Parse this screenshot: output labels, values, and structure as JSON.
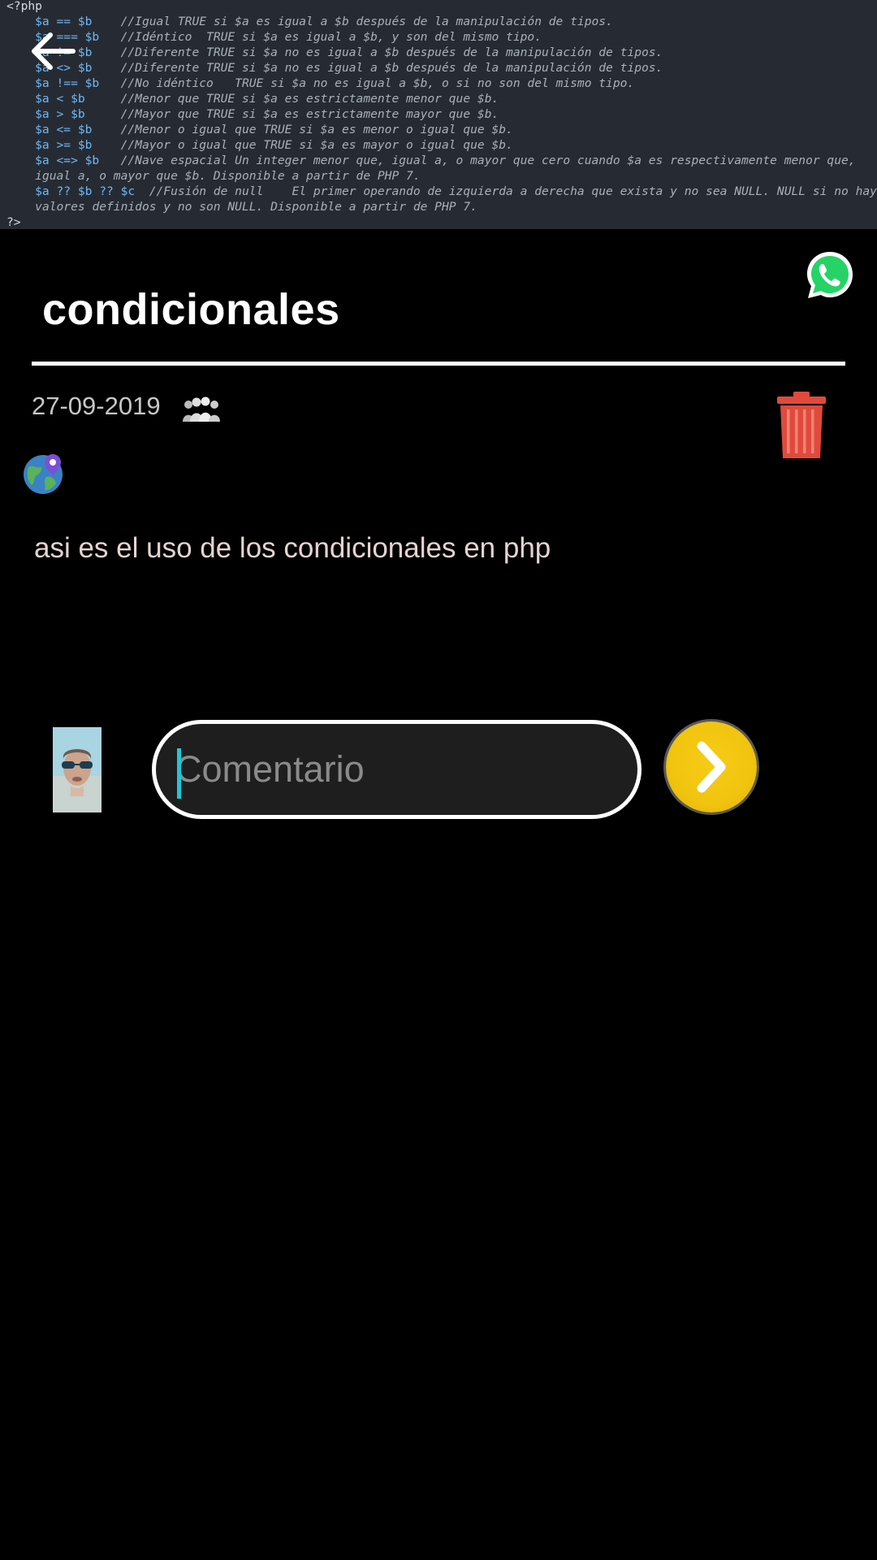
{
  "code_image": {
    "lines": [
      {
        "code": "<?php",
        "comment": ""
      },
      {
        "code": "    $a == $b    ",
        "comment": "//Igual TRUE si $a es igual a $b después de la manipulación de tipos."
      },
      {
        "code": "    $a === $b   ",
        "comment": "//Idéntico  TRUE si $a es igual a $b, y son del mismo tipo."
      },
      {
        "code": "    $a != $b    ",
        "comment": "//Diferente TRUE si $a no es igual a $b después de la manipulación de tipos."
      },
      {
        "code": "    $a <> $b    ",
        "comment": "//Diferente TRUE si $a no es igual a $b después de la manipulación de tipos."
      },
      {
        "code": "    $a !== $b   ",
        "comment": "//No idéntico   TRUE si $a no es igual a $b, o si no son del mismo tipo."
      },
      {
        "code": "    $a < $b     ",
        "comment": "//Menor que TRUE si $a es estrictamente menor que $b."
      },
      {
        "code": "    $a > $b     ",
        "comment": "//Mayor que TRUE si $a es estrictamente mayor que $b."
      },
      {
        "code": "    $a <= $b    ",
        "comment": "//Menor o igual que TRUE si $a es menor o igual que $b."
      },
      {
        "code": "    $a >= $b    ",
        "comment": "//Mayor o igual que TRUE si $a es mayor o igual que $b."
      },
      {
        "code": "    $a <=> $b   ",
        "comment": "//Nave espacial Un integer menor que, igual a, o mayor que cero cuando $a es respectivamente menor que,"
      },
      {
        "code": "    ",
        "comment": "igual a, o mayor que $b. Disponible a partir de PHP 7."
      },
      {
        "code": "    $a ?? $b ?? $c  ",
        "comment": "//Fusión de null    El primer operando de izquierda a derecha que exista y no sea NULL. NULL si no hay"
      },
      {
        "code": "    ",
        "comment": "valores definidos y no son NULL. Disponible a partir de PHP 7."
      },
      {
        "code": "?>",
        "comment": ""
      }
    ]
  },
  "header": {
    "back_icon": "arrow-left-icon",
    "share_icon": "whatsapp-icon"
  },
  "post": {
    "title": "condicionales",
    "date": "27-09-2019",
    "body": "asi es el uso de los condicionales en php",
    "audience_icon": "group-icon",
    "location_icon": "globe-pin-icon",
    "delete_icon": "trash-icon"
  },
  "comment": {
    "placeholder": "Comentario",
    "value": "",
    "send_icon": "chevron-right-icon"
  },
  "colors": {
    "background": "#000000",
    "title": "#ffffff",
    "date": "#c7c7c7",
    "body_text": "#e6d3d0",
    "send_button": "#f1c40f",
    "delete_icon": "#e04a3c",
    "whatsapp": "#25d366",
    "caret": "#1fc7d9",
    "code_background": "#262b33"
  }
}
